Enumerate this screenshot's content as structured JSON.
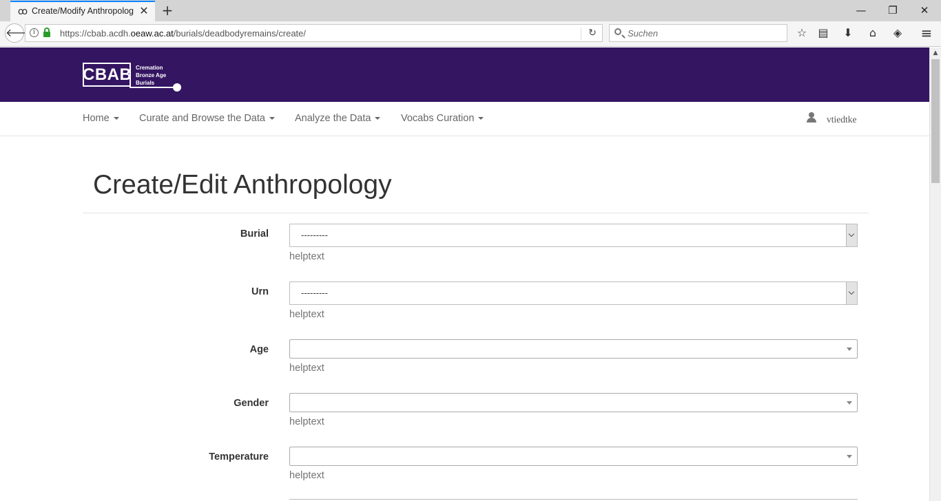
{
  "browser": {
    "tab_title": "Create/Modify Anthropolog",
    "tab_favicon": "ꝏ",
    "url_prefix": "https://cbab.acdh.",
    "url_domain": "oeaw.ac.at",
    "url_path": "/burials/deadbodyremains/create/",
    "search_placeholder": "Suchen",
    "icons": {
      "back": "🡐",
      "reload": "↻",
      "close_tab": "✕",
      "new_tab": "+",
      "minimize": "—",
      "restore": "❐",
      "close_window": "✕",
      "bookmark": "☆",
      "reader": "▤",
      "download": "⬇",
      "home": "⌂",
      "pocket": "◈",
      "menu": "≡",
      "info": "i",
      "scroll_up": "▲"
    }
  },
  "brand": {
    "logo_text": "CBAB",
    "logo_line1": "Cremation",
    "logo_line2": "Bronze Age",
    "logo_line3": "Burials",
    "color": "#341562"
  },
  "nav": {
    "items": [
      {
        "label": "Home"
      },
      {
        "label": "Curate and Browse the Data"
      },
      {
        "label": "Analyze the Data"
      },
      {
        "label": "Vocabs Curation"
      }
    ],
    "user": "vtiedtke"
  },
  "page": {
    "title": "Create/Edit Anthropology"
  },
  "form": {
    "fields": [
      {
        "label": "Burial",
        "value": "---------",
        "help": "helptext"
      },
      {
        "label": "Urn",
        "value": "---------",
        "help": "helptext"
      },
      {
        "label": "Age",
        "value": "",
        "help": "helptext"
      },
      {
        "label": "Gender",
        "value": "",
        "help": "helptext"
      },
      {
        "label": "Temperature",
        "value": "",
        "help": "helptext"
      }
    ]
  }
}
